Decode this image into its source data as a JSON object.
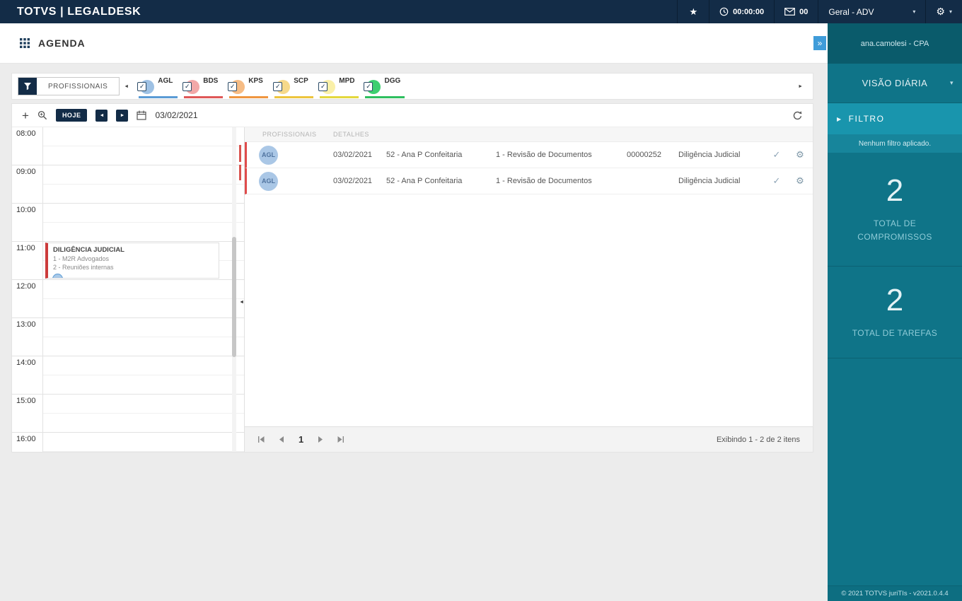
{
  "topbar": {
    "brand": "TOTVS | LEGALDESK",
    "timer": "00:00:00",
    "mail_count": "00",
    "role": "Geral - ADV"
  },
  "header": {
    "title": "AGENDA"
  },
  "icons": {
    "star": "★",
    "gear": "⚙",
    "chevron_down": "▾",
    "plus": "+",
    "prev": "◄",
    "next": "►",
    "collapse": "»",
    "scroll_left": "◄",
    "scroll_right": "►",
    "check": "✓",
    "checkbox_check": "✓",
    "filter_arrow": "▶",
    "splitter": "◄"
  },
  "professionals": {
    "filter_button": "PROFISSIONAIS",
    "chips": [
      {
        "code": "AGL",
        "css": "--circle:#9ec1e4;--line:#5b9bd5"
      },
      {
        "code": "BDS",
        "css": "--circle:#f2a8a8;--line:#df5858"
      },
      {
        "code": "KPS",
        "css": "--circle:#f6bc84;--line:#ef9640"
      },
      {
        "code": "SCP",
        "css": "--circle:#f6d98a;--line:#edc53e"
      },
      {
        "code": "MPD",
        "css": "--circle:#faf0a8;--line:#e4d83e"
      },
      {
        "code": "DGG",
        "css": "--circle:#3ecf70;--line:#2fbf5f"
      }
    ]
  },
  "toolbar": {
    "today": "HOJE",
    "date": "03/02/2021"
  },
  "calendar": {
    "times": [
      "08:00",
      "09:00",
      "10:00",
      "11:00",
      "12:00",
      "13:00",
      "14:00",
      "15:00",
      "16:00"
    ],
    "event": {
      "title": "DILIGÊNCIA JUDICIAL",
      "line1": "1 - M2R Advogados",
      "line2": "2 - Reuniões internas"
    }
  },
  "list": {
    "columns": [
      "PROFISSIONAIS",
      "DETALHES"
    ],
    "rows": [
      {
        "avatar": "AGL",
        "date": "03/02/2021",
        "client": "52 - Ana P Confeitaria",
        "task": "1 - Revisão de Documentos",
        "number": "00000252",
        "type": "Diligência Judicial"
      },
      {
        "avatar": "AGL",
        "date": "03/02/2021",
        "client": "52 - Ana P Confeitaria",
        "task": "1 - Revisão de Documentos",
        "number": "",
        "type": "Diligência Judicial"
      }
    ],
    "pagination": {
      "page": "1",
      "summary": "Exibindo 1 - 2 de 2 itens"
    }
  },
  "sidebar": {
    "account": "ana.camolesi - CPA",
    "view": "VISÃO DIÁRIA",
    "filter": "FILTRO",
    "filter_status": "Nenhum filtro aplicado.",
    "stats": [
      {
        "value": "2",
        "label": "TOTAL DE COMPROMISSOS"
      },
      {
        "value": "2",
        "label": "TOTAL DE TAREFAS"
      }
    ],
    "footer": "© 2021 TOTVS juriTIs - v2021.0.4.4"
  },
  "colors": {
    "topbar_navy": "#132c47",
    "sidebar_teal": "#0f7488",
    "accent_blue": "#3f9cd9",
    "alert_red": "#e04b4b"
  }
}
